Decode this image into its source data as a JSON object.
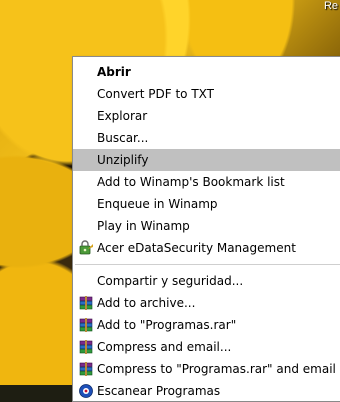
{
  "wallpaper": {
    "corner_text": "Re"
  },
  "context_menu": {
    "groups": [
      [
        {
          "label": "Abrir",
          "bold": true
        },
        {
          "label": "Convert PDF to TXT"
        },
        {
          "label": "Explorar"
        },
        {
          "label": "Buscar..."
        },
        {
          "label": "Unziplify",
          "highlighted": true
        },
        {
          "label": "Add to Winamp's Bookmark list"
        },
        {
          "label": "Enqueue in Winamp"
        },
        {
          "label": "Play in Winamp"
        },
        {
          "label": "Acer eDataSecurity Management",
          "icon": "acer-edatasecurity-icon"
        }
      ],
      [
        {
          "label": "Compartir y seguridad..."
        },
        {
          "label": "Add to archive...",
          "icon": "winrar-icon"
        },
        {
          "label": "Add to \"Programas.rar\"",
          "icon": "winrar-icon"
        },
        {
          "label": "Compress and email...",
          "icon": "winrar-icon"
        },
        {
          "label": "Compress to \"Programas.rar\" and email",
          "icon": "winrar-icon"
        },
        {
          "label": "Escanear Programas",
          "icon": "antivirus-scan-icon"
        }
      ]
    ]
  },
  "colors": {
    "highlight": "#c0c0c0",
    "menu_background": "#ffffff",
    "menu_border": "#8a8a8a"
  }
}
